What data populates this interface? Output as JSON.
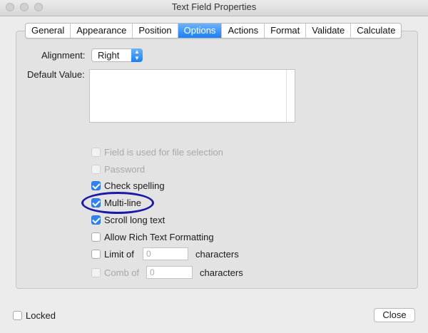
{
  "window": {
    "title": "Text Field Properties"
  },
  "tabs": [
    "General",
    "Appearance",
    "Position",
    "Options",
    "Actions",
    "Format",
    "Validate",
    "Calculate"
  ],
  "active_tab": "Options",
  "options": {
    "alignment_label": "Alignment:",
    "alignment_value": "Right",
    "default_value_label": "Default Value:",
    "default_value": "",
    "checkboxes": [
      {
        "label": "Field is used for file selection",
        "checked": false,
        "disabled": true
      },
      {
        "label": "Password",
        "checked": false,
        "disabled": true
      },
      {
        "label": "Check spelling",
        "checked": true,
        "disabled": false
      },
      {
        "label": "Multi-line",
        "checked": true,
        "disabled": false
      },
      {
        "label": "Scroll long text",
        "checked": true,
        "disabled": false
      },
      {
        "label": "Allow Rich Text Formatting",
        "checked": false,
        "disabled": false
      }
    ],
    "limit_of": {
      "label": "Limit of",
      "value": "0",
      "suffix": "characters",
      "checked": false,
      "disabled": false
    },
    "comb_of": {
      "label": "Comb of",
      "value": "0",
      "suffix": "characters",
      "checked": false,
      "disabled": true
    }
  },
  "footer": {
    "locked_label": "Locked",
    "locked_checked": false,
    "close_label": "Close"
  },
  "colors": {
    "accent": "#1a7ef5",
    "highlight_ellipse": "#1a1aa6"
  }
}
